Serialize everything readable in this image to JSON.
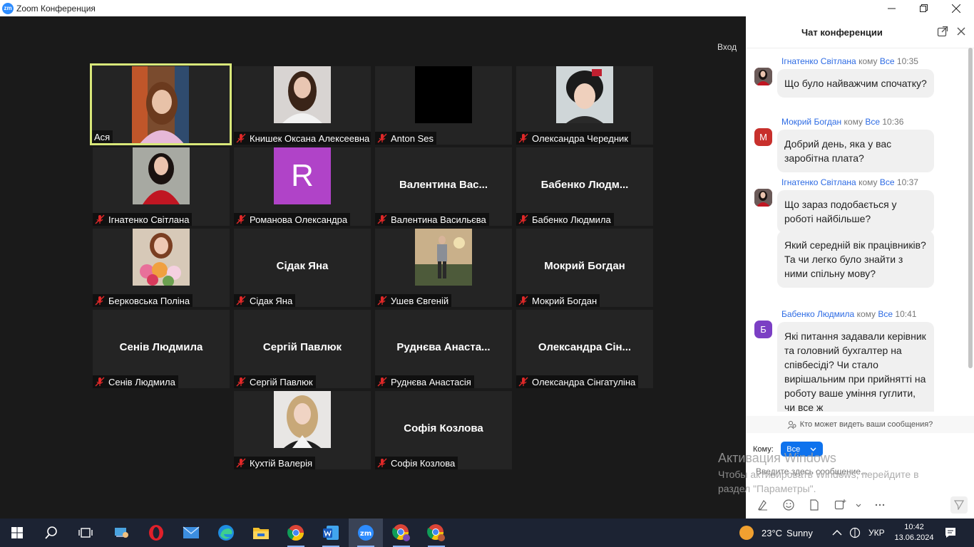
{
  "window": {
    "logo": "zm",
    "title": "Zoom Конференция",
    "controls": [
      "minimize-icon",
      "restore-icon",
      "close-icon"
    ]
  },
  "meeting": {
    "signin_label": "Вход",
    "tiles": [
      {
        "name": "Ася",
        "big_name": "",
        "has_photo": true,
        "muted": false,
        "active": true
      },
      {
        "name": "Книшек Оксана Алексеевна",
        "big_name": "",
        "has_photo": true,
        "muted": true
      },
      {
        "name": "Anton Ses",
        "big_name": "",
        "has_photo": true,
        "muted": true
      },
      {
        "name": "Олександра Чередник",
        "big_name": "",
        "has_photo": true,
        "muted": true
      },
      {
        "name": "Ігнатенко Світлана",
        "big_name": "",
        "has_photo": true,
        "muted": true
      },
      {
        "name": "Романова Олександра",
        "big_name": "",
        "has_photo": true,
        "letter": "R",
        "muted": true
      },
      {
        "name": "Валентина Васильєва",
        "big_name": "Валентина  Вас...",
        "has_photo": false,
        "muted": true
      },
      {
        "name": "Бабенко Людмила",
        "big_name": "Бабенко  Людм...",
        "has_photo": false,
        "muted": true
      },
      {
        "name": "Берковська Поліна",
        "big_name": "",
        "has_photo": true,
        "muted": true
      },
      {
        "name": "Сідак Яна",
        "big_name": "Сідак Яна",
        "has_photo": false,
        "muted": true
      },
      {
        "name": "Ушев Євгеній",
        "big_name": "",
        "has_photo": true,
        "muted": true
      },
      {
        "name": "Мокрий Богдан",
        "big_name": "Мокрий Богдан",
        "has_photo": false,
        "muted": true
      },
      {
        "name": "Сенів Людмила",
        "big_name": "Сенів Людмила",
        "has_photo": false,
        "muted": true
      },
      {
        "name": "Сергій Павлюк",
        "big_name": "Сергій Павлюк",
        "has_photo": false,
        "muted": true
      },
      {
        "name": "Руднєва Анастасія",
        "big_name": "Руднєва  Анаста...",
        "has_photo": false,
        "muted": true
      },
      {
        "name": "Олександра Сінгатуліна",
        "big_name": "Олександра  Сін...",
        "has_photo": false,
        "muted": true
      },
      {
        "name": "Кухтій Валерія",
        "big_name": "",
        "has_photo": true,
        "muted": true
      },
      {
        "name": "Софія Козлова",
        "big_name": "Софія Козлова",
        "has_photo": false,
        "muted": true
      }
    ]
  },
  "chat": {
    "title": "Чат конференции",
    "to_word": "кому",
    "to_all": "Все",
    "messages": [
      {
        "sender": "Ігнатенко Світлана",
        "time": "10:35",
        "avatar_letter": "",
        "text": "Що було найважчим спочатку?"
      },
      {
        "sender": "Мокрий Богдан",
        "time": "10:36",
        "avatar_letter": "М",
        "text": "Добрий день, яка у вас заробітна плата?"
      },
      {
        "sender": "Ігнатенко Світлана",
        "time": "10:37",
        "avatar_letter": "",
        "text": "Що зараз подобається у роботі найбільше?"
      },
      {
        "sender": "",
        "time": "",
        "avatar_letter": "",
        "text": "Який середній вік працівників? Та чи легко було знайти з ними спільну мову?"
      },
      {
        "sender": "Бабенко Людмила",
        "time": "10:41",
        "avatar_letter": "Б",
        "text": "Які питання задавали керівник та головний бухгалтер на співбесіді? Чи стало вирішальним при прийнятті на роботу ваше уміння гуглити, чи все ж"
      }
    ],
    "visibility_text": "Кто может видеть ваши сообщения?",
    "to_label": "Кому:",
    "to_value": "Все",
    "input_placeholder": "Введите здесь сообщение...",
    "toolbar_icons": [
      "format-icon",
      "emoji-icon",
      "file-icon",
      "screenshot-icon",
      "chevron-down-icon",
      "more-icon",
      "send-icon"
    ]
  },
  "watermark": {
    "line1": "Активация Windows",
    "line2": "Чтобы активировать Windows, перейдите в",
    "line3": "раздел \"Параметры\"."
  },
  "taskbar": {
    "weather_temp": "23°C",
    "weather_text": "Sunny",
    "language": "УКР",
    "time": "10:42",
    "date": "13.06.2024"
  },
  "colors": {
    "accent": "#0e72ed",
    "link": "#2d6be4",
    "active_border": "#d9e87a",
    "mute_red": "#e02828",
    "taskbar": "#1c2333"
  }
}
